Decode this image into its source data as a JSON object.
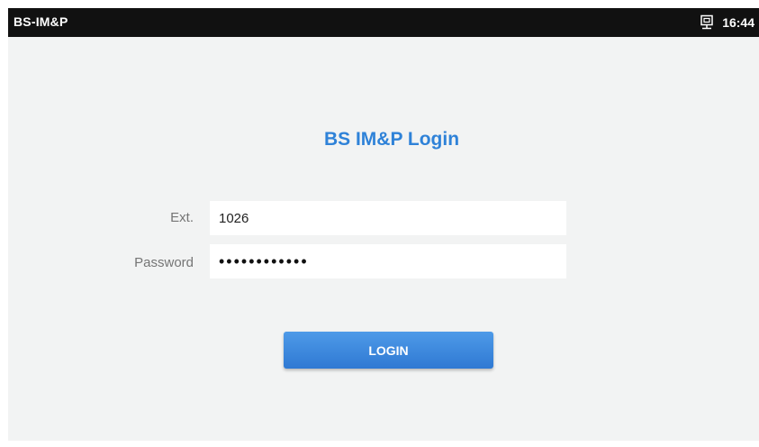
{
  "statusbar": {
    "app_title": "BS-IM&P",
    "time": "16:44",
    "network_icon": "ethernet-icon"
  },
  "login": {
    "title": "BS IM&P Login",
    "ext_label": "Ext.",
    "ext_value": "1026",
    "password_label": "Password",
    "password_value": "••••••••••••",
    "button_label": "LOGIN"
  },
  "colors": {
    "statusbar_bg": "#111111",
    "background": "#f2f3f3",
    "title": "#2f82d8",
    "label": "#757575",
    "button": "#3585dc"
  }
}
